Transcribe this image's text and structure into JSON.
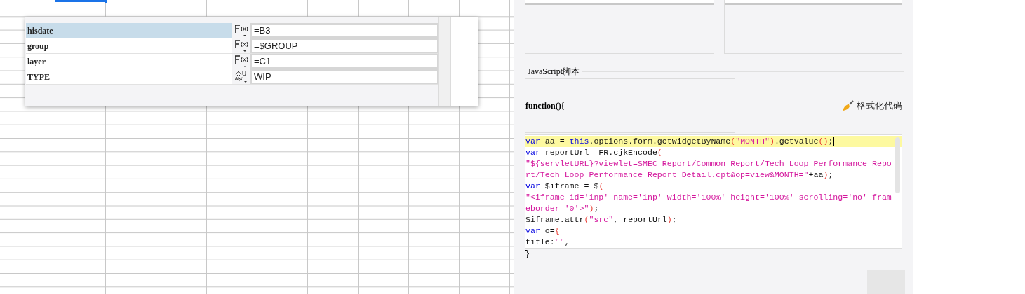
{
  "parameters_popup": {
    "rows": [
      {
        "name": "hisdate",
        "kind": "formula",
        "value": "=B3",
        "selected": true
      },
      {
        "name": "group",
        "kind": "formula",
        "value": "=$GROUP",
        "selected": false
      },
      {
        "name": "layer",
        "kind": "formula",
        "value": "=C1",
        "selected": false
      },
      {
        "name": "TYPE",
        "kind": "text",
        "value": "WIP",
        "selected": false
      }
    ]
  },
  "script_panel": {
    "section_label": "JavaScript脚本",
    "function_header": "function(){",
    "format_button": "格式化代码",
    "code_lines": [
      {
        "highlighted": true,
        "tokens": [
          {
            "kind": "keyword",
            "text": "var"
          },
          {
            "kind": "plain",
            "text": " aa = "
          },
          {
            "kind": "keyword",
            "text": "this"
          },
          {
            "kind": "plain",
            "text": ".options.form.getWidgetByName"
          },
          {
            "kind": "paren",
            "text": "("
          },
          {
            "kind": "string",
            "text": "\"MONTH\""
          },
          {
            "kind": "paren",
            "text": ")"
          },
          {
            "kind": "plain",
            "text": ".getValue"
          },
          {
            "kind": "paren",
            "text": "()"
          },
          {
            "kind": "plain",
            "text": ";"
          }
        ]
      },
      {
        "highlighted": false,
        "tokens": [
          {
            "kind": "keyword",
            "text": "var"
          },
          {
            "kind": "plain",
            "text": " reportUrl =FR.cjkEncode"
          },
          {
            "kind": "paren",
            "text": "("
          }
        ]
      },
      {
        "highlighted": false,
        "tokens": [
          {
            "kind": "string",
            "text": "\"${servletURL}?viewlet=SMEC Report/Common Report/Tech Loop Performance Repo"
          }
        ]
      },
      {
        "highlighted": false,
        "tokens": [
          {
            "kind": "string",
            "text": "rt/Tech Loop Performance Report Detail.cpt&op=view&MONTH=\""
          },
          {
            "kind": "plain",
            "text": "+aa"
          },
          {
            "kind": "paren",
            "text": ")"
          },
          {
            "kind": "plain",
            "text": ";"
          }
        ]
      },
      {
        "highlighted": false,
        "tokens": [
          {
            "kind": "keyword",
            "text": "var"
          },
          {
            "kind": "plain",
            "text": " $iframe = $"
          },
          {
            "kind": "paren",
            "text": "("
          }
        ]
      },
      {
        "highlighted": false,
        "tokens": [
          {
            "kind": "string",
            "text": "\"<iframe id='inp' name='inp' width='100%' height='100%' scrolling='no' fram"
          }
        ]
      },
      {
        "highlighted": false,
        "tokens": [
          {
            "kind": "string",
            "text": "eborder='0'>\""
          },
          {
            "kind": "paren",
            "text": ")"
          },
          {
            "kind": "plain",
            "text": ";"
          }
        ]
      },
      {
        "highlighted": false,
        "tokens": [
          {
            "kind": "plain",
            "text": "$iframe.attr"
          },
          {
            "kind": "paren",
            "text": "("
          },
          {
            "kind": "string",
            "text": "\"src\""
          },
          {
            "kind": "plain",
            "text": ", reportUrl"
          },
          {
            "kind": "paren",
            "text": ")"
          },
          {
            "kind": "plain",
            "text": ";"
          }
        ]
      },
      {
        "highlighted": false,
        "tokens": [
          {
            "kind": "keyword",
            "text": "var"
          },
          {
            "kind": "plain",
            "text": " o="
          },
          {
            "kind": "paren",
            "text": "{"
          }
        ]
      },
      {
        "highlighted": false,
        "tokens": [
          {
            "kind": "plain",
            "text": "title:"
          },
          {
            "kind": "string",
            "text": "\"\""
          },
          {
            "kind": "plain",
            "text": ","
          }
        ]
      }
    ],
    "closing_brace": "}"
  }
}
